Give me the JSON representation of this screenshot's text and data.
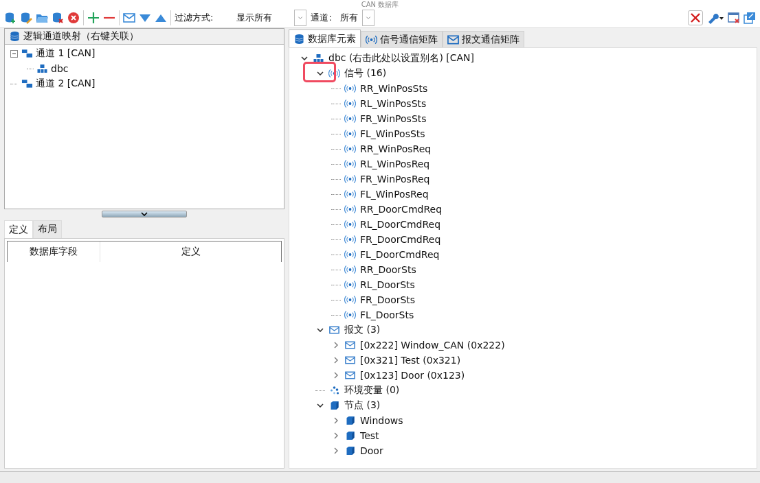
{
  "window": {
    "title": "CAN 数据库"
  },
  "toolbar": {
    "filter_label": "过滤方式:",
    "filter_value": "显示所有",
    "channel_label": "通道:",
    "channel_value": "所有"
  },
  "left_panel": {
    "title": "逻辑通道映射（右键关联）",
    "tree": [
      {
        "label": "通道 1 [CAN]",
        "children": [
          {
            "label": "dbc"
          }
        ]
      },
      {
        "label": "通道 2 [CAN]"
      }
    ]
  },
  "bottom_tabs": [
    {
      "label": "定义",
      "selected": true
    },
    {
      "label": "布局",
      "selected": false
    }
  ],
  "definition_table": {
    "columns": [
      "数据库字段",
      "定义"
    ]
  },
  "right_tabs": [
    {
      "label": "数据库元素",
      "kind": "database",
      "selected": true
    },
    {
      "label": "信号通信矩阵",
      "kind": "signal",
      "selected": false
    },
    {
      "label": "报文通信矩阵",
      "kind": "message",
      "selected": false
    }
  ],
  "db_tree": {
    "label": "dbc (右击此处以设置别名) [CAN]",
    "kind": "database",
    "expanded": true,
    "children": [
      {
        "label": "信号 (16)",
        "kind": "signal",
        "expanded": true,
        "highlighted": true,
        "children": [
          {
            "label": "RR_WinPosSts",
            "kind": "signal"
          },
          {
            "label": "RL_WinPosSts",
            "kind": "signal"
          },
          {
            "label": "FR_WinPosSts",
            "kind": "signal"
          },
          {
            "label": "FL_WinPosSts",
            "kind": "signal"
          },
          {
            "label": "RR_WinPosReq",
            "kind": "signal"
          },
          {
            "label": "RL_WinPosReq",
            "kind": "signal"
          },
          {
            "label": "FR_WinPosReq",
            "kind": "signal"
          },
          {
            "label": "FL_WinPosReq",
            "kind": "signal"
          },
          {
            "label": "RR_DoorCmdReq",
            "kind": "signal"
          },
          {
            "label": "RL_DoorCmdReq",
            "kind": "signal"
          },
          {
            "label": "FR_DoorCmdReq",
            "kind": "signal"
          },
          {
            "label": "FL_DoorCmdReq",
            "kind": "signal"
          },
          {
            "label": "RR_DoorSts",
            "kind": "signal"
          },
          {
            "label": "RL_DoorSts",
            "kind": "signal"
          },
          {
            "label": "FR_DoorSts",
            "kind": "signal"
          },
          {
            "label": "FL_DoorSts",
            "kind": "signal"
          }
        ]
      },
      {
        "label": "报文 (3)",
        "kind": "message",
        "expanded": true,
        "children": [
          {
            "label": "[0x222] Window_CAN (0x222)",
            "kind": "message",
            "expanded": false
          },
          {
            "label": "[0x321] Test (0x321)",
            "kind": "message",
            "expanded": false
          },
          {
            "label": "[0x123] Door (0x123)",
            "kind": "message",
            "expanded": false
          }
        ]
      },
      {
        "label": "环境变量 (0)",
        "kind": "variable"
      },
      {
        "label": "节点 (3)",
        "kind": "node",
        "expanded": true,
        "children": [
          {
            "label": "Windows",
            "kind": "node",
            "expanded": false
          },
          {
            "label": "Test",
            "kind": "node",
            "expanded": false
          },
          {
            "label": "Door",
            "kind": "node",
            "expanded": false
          }
        ]
      }
    ]
  }
}
